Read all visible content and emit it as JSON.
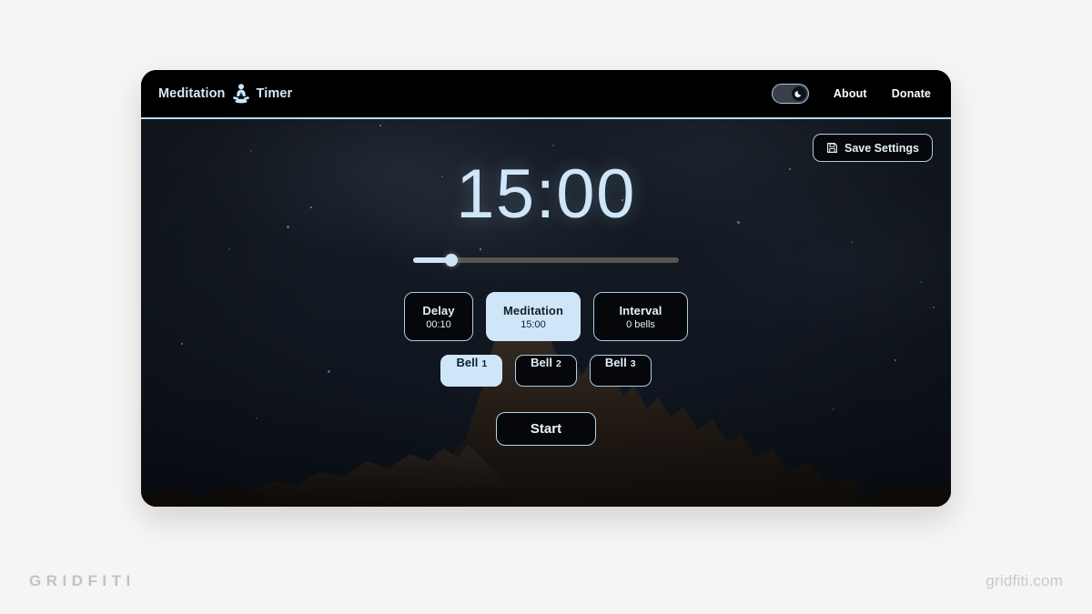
{
  "header": {
    "brand_word_1": "Meditation",
    "brand_icon": "lotus-meditation-icon",
    "brand_word_2": "Timer",
    "theme_toggle": {
      "icon": "moon-icon",
      "state": "dark",
      "label": "Dark mode"
    },
    "nav": [
      {
        "label": "About"
      },
      {
        "label": "Donate"
      }
    ]
  },
  "toolbar": {
    "save_label": "Save Settings",
    "save_icon": "floppy-save-icon"
  },
  "main": {
    "timer": "15:00",
    "slider": {
      "value_percent": 14,
      "fill_color": "#cfe4f6",
      "track_color": "#585550"
    },
    "modes": [
      {
        "title": "Delay",
        "sub": "00:10",
        "active": false
      },
      {
        "title": "Meditation",
        "sub": "15:00",
        "active": true
      },
      {
        "title": "Interval",
        "sub": "0 bells",
        "active": false
      }
    ],
    "bells": [
      {
        "label": "Bell",
        "num": "1",
        "active": true
      },
      {
        "label": "Bell",
        "num": "2",
        "active": false
      },
      {
        "label": "Bell",
        "num": "3",
        "active": false
      }
    ],
    "start_label": "Start"
  },
  "watermarks": {
    "left": "GRIDFITI",
    "right": "gridfiti.com"
  },
  "colors": {
    "accent_light_blue": "#cfe6f8",
    "header_bg": "#000000",
    "rule": "#b9d9ed",
    "page_bg": "#f5f5f4",
    "card_bg": "#11161d"
  }
}
